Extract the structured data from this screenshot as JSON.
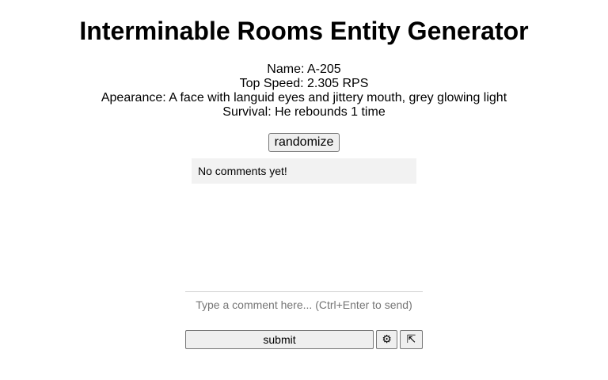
{
  "page": {
    "title": "Interminable Rooms Entity Generator"
  },
  "entity": {
    "name": "Name: A-205",
    "top_speed": "Top Speed: 2.305 RPS",
    "appearance": "Apearance: A face with languid eyes and jittery mouth, grey glowing light",
    "survival": "Survival: He rebounds 1 time"
  },
  "controls": {
    "randomize_label": "randomize"
  },
  "comments": {
    "empty_text": "No comments yet!",
    "input_placeholder": "Type a comment here... (Ctrl+Enter to send)",
    "input_value": "",
    "submit_label": "submit",
    "settings_glyph": "⚙",
    "settings_icon": "gear-icon",
    "expand_glyph": "⇱",
    "expand_icon": "expand-icon"
  }
}
